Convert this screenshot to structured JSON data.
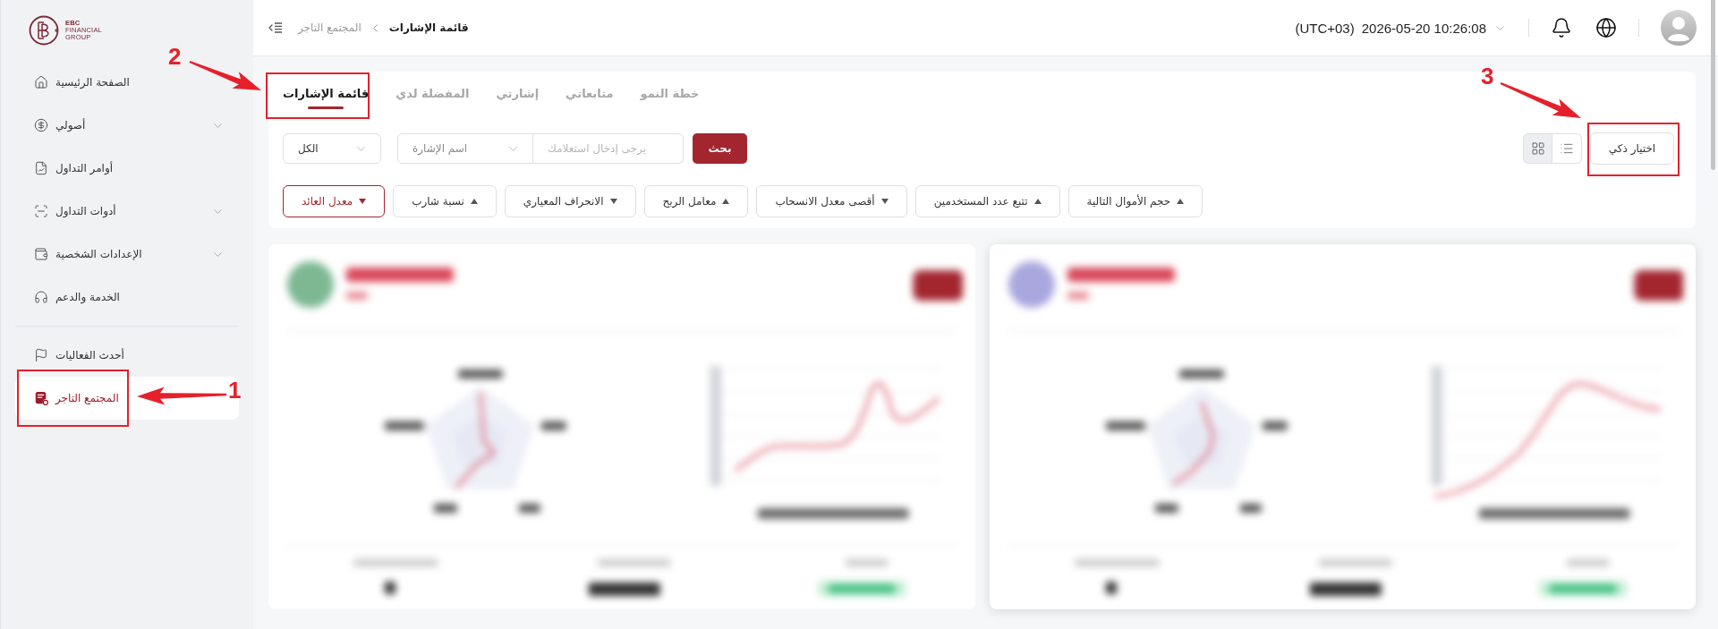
{
  "sidebar": {
    "logo": {
      "lines": [
        "EBC",
        "FINANCIAL",
        "GROUP"
      ]
    },
    "sections": [
      {
        "items": [
          {
            "label": "الصفحة الرئيسية",
            "kind": "link",
            "selected": false
          },
          {
            "label": "أصولي",
            "kind": "group",
            "selected": false
          },
          {
            "label": "أوامر التداول",
            "kind": "link",
            "selected": false
          },
          {
            "label": "أدوات التداول",
            "kind": "group",
            "selected": false
          },
          {
            "label": "الإعدادات الشخصية",
            "kind": "group",
            "selected": false
          },
          {
            "label": "الخدمة والدعم",
            "kind": "link",
            "selected": false
          }
        ]
      },
      {
        "items": [
          {
            "label": "أحدث الفعاليات",
            "kind": "link",
            "selected": false
          },
          {
            "label": "المجتمع التاجر",
            "kind": "link",
            "selected": true
          }
        ]
      }
    ]
  },
  "header": {
    "breadcrumb": [
      {
        "label": "قائمة الإشارات",
        "current": true
      },
      {
        "label": "المجتمع التاجر",
        "current": false
      }
    ],
    "timezone": "(UTC+03)",
    "datetime": "2026-05-20 10:26:08"
  },
  "tabs": [
    {
      "label": "خطة النمو",
      "selected": false
    },
    {
      "label": "متابعاتي",
      "selected": false
    },
    {
      "label": "إشارتي",
      "selected": false
    },
    {
      "label": "المفضلة لدي",
      "selected": false
    },
    {
      "label": "قائمة الإشارات",
      "selected": true
    }
  ],
  "filters": {
    "status_select": {
      "value": "الكل"
    },
    "search_type_select": {
      "value": "اسم الإشارة"
    },
    "search_field": {
      "placeholder": "يرجى إدخال استعلامك"
    },
    "search_button": "بحث"
  },
  "view_toggle": [
    {
      "kind": "grid",
      "selected": true
    },
    {
      "kind": "list",
      "selected": false
    }
  ],
  "smart_select_button": "اختيار ذكي",
  "sort_chips": [
    {
      "label": "حجم الأموال التالية",
      "ascending": true,
      "selected": false
    },
    {
      "label": "تتبع عدد المستخدمين",
      "ascending": true,
      "selected": false
    },
    {
      "label": "أقصى معدل الانسحاب",
      "ascending": false,
      "selected": false
    },
    {
      "label": "معامل الربح",
      "ascending": true,
      "selected": false
    },
    {
      "label": "الانحراف المعياري",
      "ascending": false,
      "selected": false
    },
    {
      "label": "نسبة شارب",
      "ascending": true,
      "selected": false
    },
    {
      "label": "معدل العائد",
      "ascending": false,
      "selected": true
    }
  ],
  "cards": [
    {
      "hovered": false
    },
    {
      "hovered": true
    }
  ],
  "annotations": [
    {
      "label": "1"
    },
    {
      "label": "2"
    },
    {
      "label": "3"
    }
  ]
}
